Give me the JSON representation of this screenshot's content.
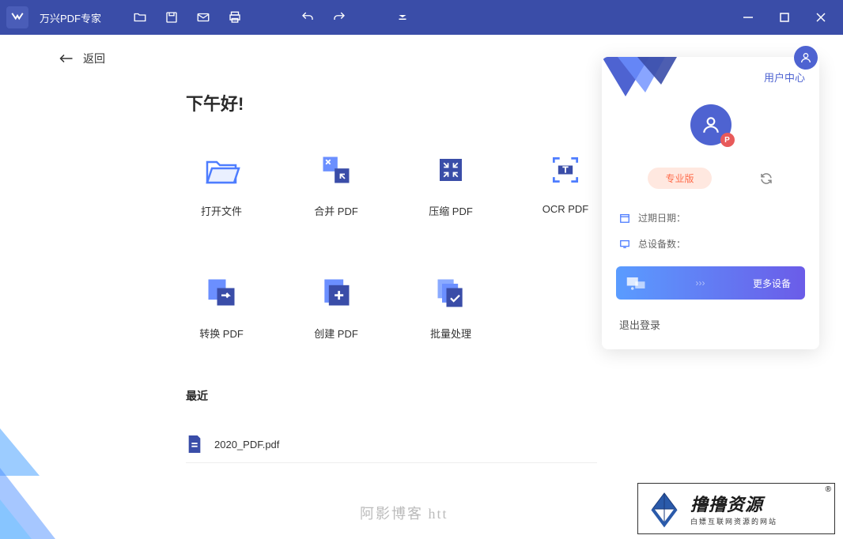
{
  "app": {
    "title": "万兴PDF专家"
  },
  "nav": {
    "back": "返回"
  },
  "greeting": "下午好!",
  "actions": [
    {
      "label": "打开文件"
    },
    {
      "label": "合并 PDF"
    },
    {
      "label": "压缩 PDF"
    },
    {
      "label": "OCR PDF"
    },
    {
      "label": "转换 PDF"
    },
    {
      "label": "创建 PDF"
    },
    {
      "label": "批量处理"
    }
  ],
  "recent": {
    "title": "最近",
    "items": [
      {
        "name": "2020_PDF.pdf"
      }
    ]
  },
  "userPanel": {
    "centerLink": "用户中心",
    "plan": "专业版",
    "expireLabel": "过期日期：",
    "devicesLabel": "总设备数：",
    "moreDevices": "更多设备",
    "logout": "退出登录",
    "avatarBadge": "P"
  },
  "watermark": {
    "text": "阿影博客 htt",
    "logoMain": "撸撸资源",
    "logoSub": "白嫖互联网资源的网站",
    "registered": "®"
  }
}
